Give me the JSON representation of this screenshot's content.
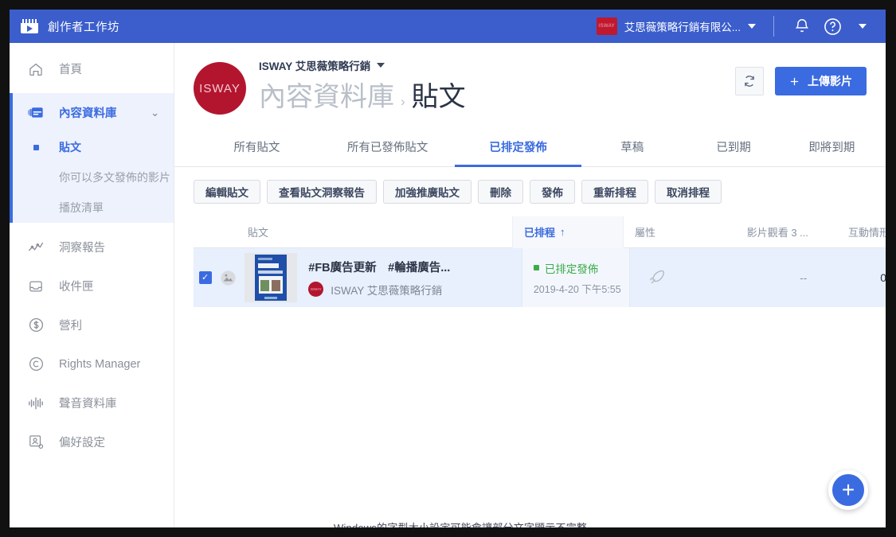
{
  "topbar": {
    "app_title": "創作者工作坊",
    "logo_icon": "clapperboard-play-icon",
    "account_name": "艾思薇策略行銷有限公...",
    "account_avatar_text": "ISWAY",
    "account_caret_icon": "chevron-down-icon",
    "bell_icon": "notification-bell-icon",
    "help_icon": "help-circle-icon",
    "menu_caret_icon": "chevron-down-icon",
    "accent_color": "#3b5ecc"
  },
  "sidebar": {
    "items": [
      {
        "label": "首頁",
        "icon": "home-icon"
      },
      {
        "label": "洞察報告",
        "icon": "analytics-line-icon"
      },
      {
        "label": "收件匣",
        "icon": "inbox-icon"
      },
      {
        "label": "營利",
        "icon": "dollar-circle-icon"
      },
      {
        "label": "Rights Manager",
        "icon": "copyright-circle-icon"
      },
      {
        "label": "聲音資料庫",
        "icon": "audio-waveform-icon"
      },
      {
        "label": "偏好設定",
        "icon": "user-settings-icon"
      }
    ],
    "group": {
      "label": "內容資料庫",
      "icon": "media-library-icon",
      "chevron_icon": "chevron-down-icon",
      "sub_items": [
        {
          "label": "貼文",
          "active": true
        },
        {
          "label": "你可以多文發佈的影片",
          "active": false
        },
        {
          "label": "播放清單",
          "active": false
        }
      ]
    },
    "active_color": "#3b6be0"
  },
  "page_header": {
    "brand_avatar_text": "ISWAY",
    "brand_color": "#b3152f",
    "page_owner": "ISWAY 艾思薇策略行銷",
    "owner_caret_icon": "chevron-down-icon",
    "breadcrumb_parent": "內容資料庫",
    "breadcrumb_separator": "›",
    "breadcrumb_current": "貼文",
    "refresh_icon": "refresh-icon",
    "upload_label": "上傳影片",
    "upload_plus_icon": "plus-icon"
  },
  "tabs": [
    {
      "label": "所有貼文",
      "active": false
    },
    {
      "label": "所有已發佈貼文",
      "active": false
    },
    {
      "label": "已排定發佈",
      "active": true
    },
    {
      "label": "草稿",
      "active": false
    },
    {
      "label": "已到期",
      "active": false
    },
    {
      "label": "即將到期",
      "active": false
    }
  ],
  "action_buttons": [
    {
      "label": "編輯貼文"
    },
    {
      "label": "查看貼文洞察報告"
    },
    {
      "label": "加強推廣貼文"
    },
    {
      "label": "刪除"
    },
    {
      "label": "發佈"
    },
    {
      "label": "重新排程"
    },
    {
      "label": "取消排程"
    }
  ],
  "table": {
    "columns": {
      "post": "貼文",
      "scheduled": "已排程",
      "scheduled_sort_icon": "sort-ascending-arrow-icon",
      "attributes": "屬性",
      "views": "影片觀看 3 ...",
      "engagement": "互動情形"
    },
    "rows": [
      {
        "checkbox_checked": true,
        "checkbox_icon": "check-icon",
        "media_type_icon": "photo-circle-icon",
        "thumbnail_icon": "video-thumbnail",
        "title": "#FB廣告更新　#輪播廣告...",
        "author": "ISWAY 艾思薇策略行銷",
        "author_avatar_text": "ISWAY",
        "status": "已排定發佈",
        "status_color": "#3dab4a",
        "scheduled_date": "2019-4-20 下午5:55",
        "attribute_icon": "rocket-icon",
        "views": "--",
        "engagement": "0"
      }
    ]
  },
  "fab": {
    "icon": "plus-icon",
    "color": "#3b6be0"
  },
  "bottom_strip": {
    "clipped_text": "Windows的字型大小設定可能會讓部分文字顯示不完整"
  }
}
